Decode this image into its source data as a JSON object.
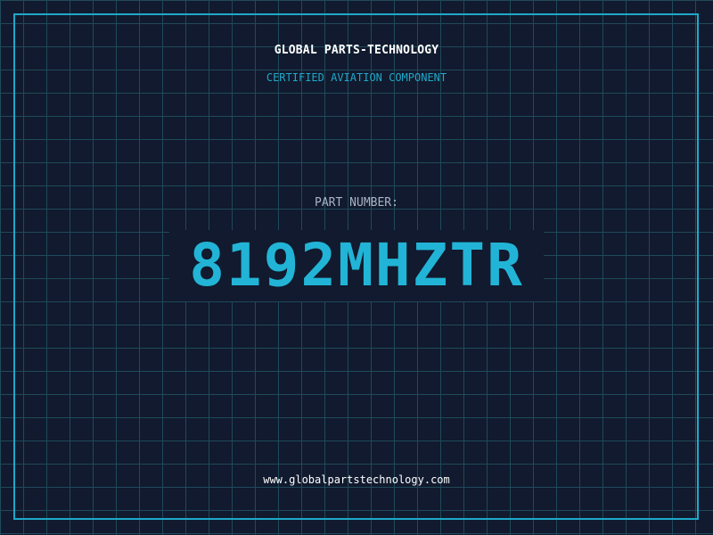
{
  "header": {
    "company_name": "GLOBAL PARTS-TECHNOLOGY",
    "tagline": "CERTIFIED AVIATION COMPONENT"
  },
  "part": {
    "label": "PART NUMBER:",
    "number": "8192MHZTR"
  },
  "footer": {
    "website": "www.globalpartstechnology.com"
  },
  "colors": {
    "background": "#111a2e",
    "grid": "#1f4a5a",
    "accent": "#22b4d6",
    "label": "#a9b4c6",
    "title": "#ffffff"
  }
}
